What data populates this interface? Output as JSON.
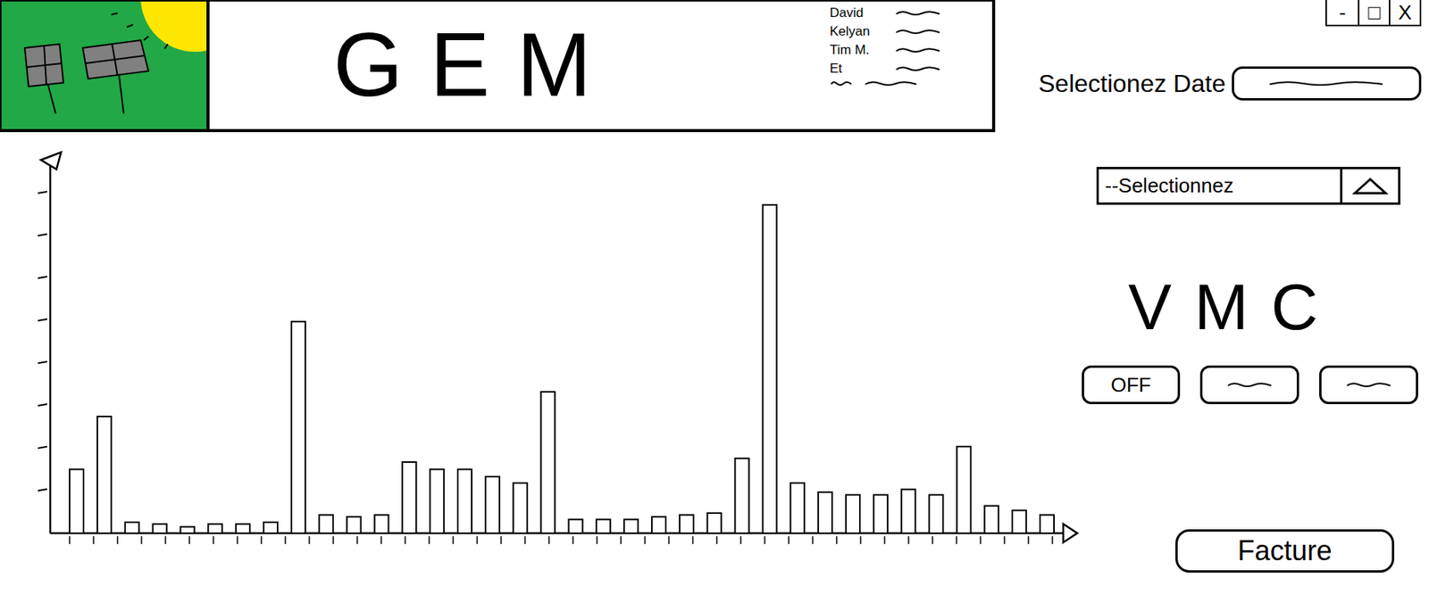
{
  "window": {
    "controls": [
      "-",
      "□",
      "X"
    ]
  },
  "header": {
    "title": "GEM",
    "credits": [
      "David",
      "Kelyan",
      "Tim M.",
      "Et"
    ]
  },
  "date": {
    "label": "Selectionez Date"
  },
  "select": {
    "placeholder": "--Selectionnez"
  },
  "vmc": {
    "title": "VMC",
    "buttons": [
      {
        "kind": "text",
        "label": "OFF"
      },
      {
        "kind": "squiggle"
      },
      {
        "kind": "squiggle"
      }
    ]
  },
  "chart": {
    "values": [
      70,
      128,
      12,
      10,
      7,
      10,
      10,
      12,
      232,
      20,
      18,
      20,
      78,
      70,
      70,
      62,
      55,
      155,
      15,
      15,
      15,
      18,
      20,
      22,
      82,
      360,
      55,
      45,
      42,
      42,
      48,
      42,
      95,
      30,
      25,
      20
    ]
  },
  "invoice_button": "Facture"
}
